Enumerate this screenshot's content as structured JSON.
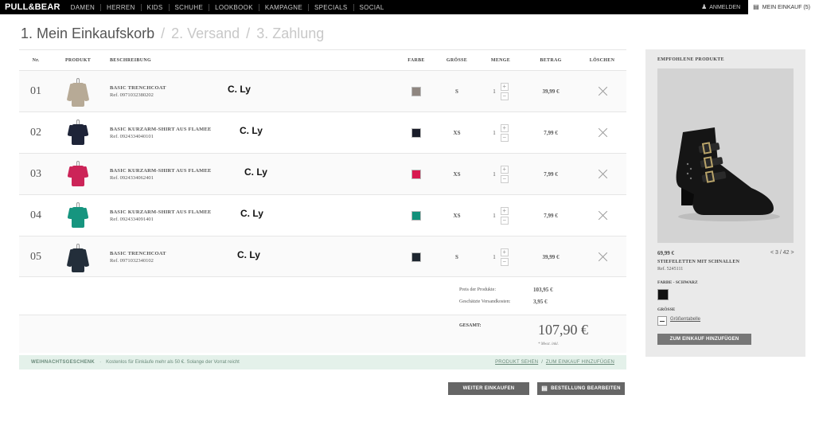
{
  "brand": {
    "logo": "PULL&BEAR"
  },
  "nav": {
    "items": [
      "DAMEN",
      "HERREN",
      "KIDS",
      "SCHUHE",
      "LOOKBOOK",
      "KAMPAGNE",
      "SPECIALS",
      "SOCIAL"
    ],
    "login": "ANMELDEN",
    "cart": "MEIN EINKAUF (5)"
  },
  "steps": {
    "step1": "1. Mein Einkaufskorb",
    "sep": "/",
    "step2": "2. Versand",
    "step3": "3. Zahlung"
  },
  "table": {
    "headers": {
      "nr": "Nr.",
      "produkt": "PRODUKT",
      "beschreibung": "BESCHREIBUNG",
      "farbe": "FARBE",
      "groesse": "GRÖSSE",
      "menge": "MENGE",
      "betrag": "BETRAG",
      "loeschen": "LÖSCHEN"
    },
    "rows": [
      {
        "nr": "01",
        "title": "BASIC TRENCHCOAT",
        "ref": "Ref. 0971032380202",
        "overlay": "C. Ly",
        "color": "#8f8680",
        "product_color": "#b7aa96",
        "size": "S",
        "qty": "1",
        "price": "39,99 €"
      },
      {
        "nr": "02",
        "title": "BASIC KURZARM-SHIRT AUS FLAMEE",
        "ref": "Ref. 0924334040101",
        "overlay": "C. Ly",
        "color": "#1a1d2a",
        "product_color": "#1e2438",
        "size": "XS",
        "qty": "1",
        "price": "7,99 €"
      },
      {
        "nr": "03",
        "title": "BASIC KURZARM-SHIRT AUS FLAMEE",
        "ref": "Ref. 0924334062401",
        "overlay": "C. Ly",
        "color": "#d8184f",
        "product_color": "#cc2458",
        "size": "XS",
        "qty": "1",
        "price": "7,99 €"
      },
      {
        "nr": "04",
        "title": "BASIC KURZARM-SHIRT AUS FLAMEE",
        "ref": "Ref. 0924334091401",
        "overlay": "C. Ly",
        "color": "#12907a",
        "product_color": "#16957f",
        "size": "XS",
        "qty": "1",
        "price": "7,99 €"
      },
      {
        "nr": "05",
        "title": "BASIC TRENCHCOAT",
        "ref": "Ref. 0971032340102",
        "overlay": "C. Ly",
        "color": "#1e2630",
        "product_color": "#232e3a",
        "size": "S",
        "qty": "1",
        "price": "39,99 €"
      }
    ],
    "plus": "+",
    "minus": "−"
  },
  "summary": {
    "products_label": "Preis der Produkte:",
    "products_value": "103,95 €",
    "shipping_label": "Geschätzte Versandkosten:",
    "shipping_value": "3,95 €",
    "total_label": "GESAMT:",
    "total_value": "107,90 €",
    "vat": "* Mwst. inkl."
  },
  "promo": {
    "title": "WEIHNACHTSGESCHENK",
    "sep": "·",
    "text": "Kostenlos für Einkäufe mehr als 50 €. Solange der Vorrat reicht",
    "link1": "PRODUKT SEHEN",
    "link_sep": "/",
    "link2": "ZUM EINKAUF HINZUFÜGEN"
  },
  "buttons": {
    "continue": "WEITER EINKAUFEN",
    "checkout": "BESTELLUNG BEARBEITEN"
  },
  "recommended": {
    "title": "EMPFOHLENE PRODUKTE",
    "price": "69,99 €",
    "pager": "< 3 / 42 >",
    "name": "STIEFELETTEN MIT SCHNALLEN",
    "ref": "Ref. 5245111",
    "color_label": "FARBE - SCHWARZ",
    "size_label": "GRÖSSE",
    "size_table": "Größentabelle",
    "add_button": "ZUM EINKAUF HINZUFÜGEN"
  }
}
